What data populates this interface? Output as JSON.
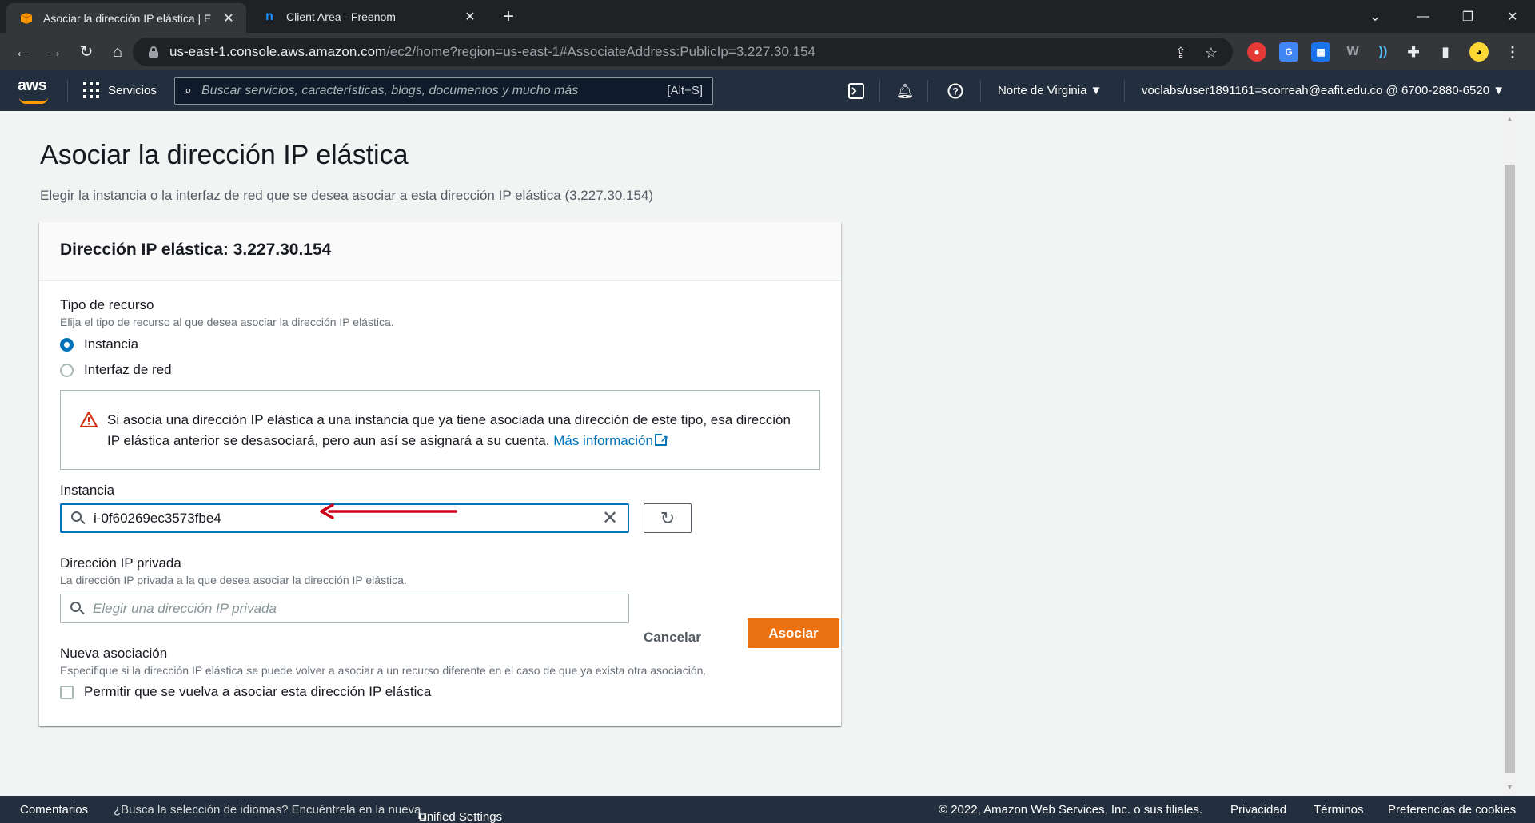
{
  "browser": {
    "tabs": [
      {
        "title": "Asociar la dirección IP elástica | E",
        "active": true
      },
      {
        "title": "Client Area - Freenom",
        "active": false
      }
    ],
    "url_host": "us-east-1.console.aws.amazon.com",
    "url_rest": "/ec2/home?region=us-east-1#AssociateAddress:PublicIp=3.227.30.154"
  },
  "awsnav": {
    "logo": "aws",
    "services_label": "Servicios",
    "search_placeholder": "Buscar servicios, características, blogs, documentos y mucho más",
    "search_shortcut": "[Alt+S]",
    "region": "Norte de Virginia ▼",
    "account": "voclabs/user1891161=scorreah@eafit.edu.co @ 6700-2880-6520 ▼"
  },
  "page": {
    "title": "Asociar la dirección IP elástica",
    "subtitle": "Elegir la instancia o la interfaz de red que se desea asociar a esta dirección IP elástica (3.227.30.154)"
  },
  "panel": {
    "title": "Dirección IP elástica: 3.227.30.154",
    "resource_type": {
      "label": "Tipo de recurso",
      "description": "Elija el tipo de recurso al que desea asociar la dirección IP elástica.",
      "options": [
        "Instancia",
        "Interfaz de red"
      ],
      "selected": "Instancia"
    },
    "alert": {
      "text": "Si asocia una dirección IP elástica a una instancia que ya tiene asociada una dirección de este tipo, esa dirección IP elástica anterior se desasociará, pero aun así se asignará a su cuenta.",
      "link": "Más información"
    },
    "instance": {
      "label": "Instancia",
      "value": "i-0f60269ec3573fbe4"
    },
    "private_ip": {
      "label": "Dirección IP privada",
      "description": "La dirección IP privada a la que desea asociar la dirección IP elástica.",
      "placeholder": "Elegir una dirección IP privada"
    },
    "reassoc": {
      "label": "Nueva asociación",
      "description": "Especifique si la dirección IP elástica se puede volver a asociar a un recurso diferente en el caso de que ya exista otra asociación.",
      "checkbox_label": "Permitir que se vuelva a asociar esta dirección IP elástica",
      "checked": false
    }
  },
  "actions": {
    "cancel": "Cancelar",
    "submit": "Asociar"
  },
  "footer": {
    "feedback": "Comentarios",
    "lang_prompt": "¿Busca la selección de idiomas? Encuéntrela en la nueva",
    "unified": "Unified Settings",
    "copyright": "© 2022, Amazon Web Services, Inc. o sus filiales.",
    "privacy": "Privacidad",
    "terms": "Términos",
    "cookies": "Preferencias de cookies"
  },
  "colors": {
    "aws_nav": "#232f3e",
    "primary_button": "#ec7211",
    "link": "#0073bb",
    "warning": "#d13212",
    "annotation_arrow": "#d0021b"
  }
}
